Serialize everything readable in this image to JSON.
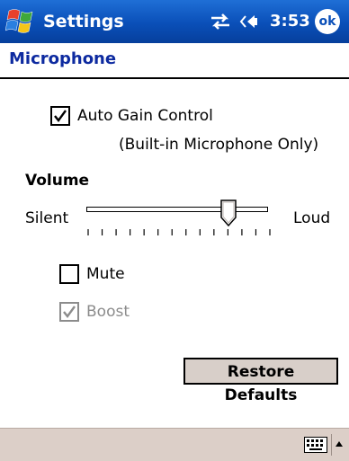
{
  "titlebar": {
    "title": "Settings",
    "time": "3:53",
    "ok_label": "ok",
    "icons": [
      "windows-start-icon",
      "connectivity-icon",
      "speaker-icon"
    ]
  },
  "page": {
    "title": "Microphone"
  },
  "auto_gain": {
    "label": "Auto Gain Control",
    "note": "(Built-in Microphone Only)",
    "checked": true
  },
  "volume": {
    "section_label": "Volume",
    "min_label": "Silent",
    "max_label": "Loud",
    "level_fraction": 0.78,
    "tick_count": 14
  },
  "mute": {
    "label": "Mute",
    "checked": false
  },
  "boost": {
    "label": "Boost",
    "checked": true,
    "enabled": false
  },
  "restore_button": {
    "label": "Restore Defaults"
  },
  "menubar": {
    "icons": [
      "keyboard-icon",
      "input-panel-arrow-icon"
    ]
  },
  "colors": {
    "titlebar": "#0a4fb8",
    "page_title": "#0d2aa0",
    "menubar": "#dccfc8",
    "button_face": "#d8cfc9",
    "disabled_text": "#8c8c8c"
  }
}
